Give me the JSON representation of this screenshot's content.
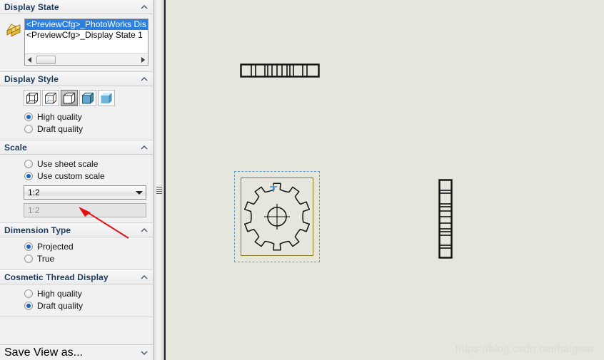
{
  "app": {
    "name": "SolidWorks Drawing View PropertyManager"
  },
  "panel": {
    "sections": [
      {
        "id": "display-state",
        "title": "Display State",
        "collapse_icon": "chevron-up-icon",
        "icon": "display-state-block-icon",
        "list": {
          "items": [
            {
              "label": "<PreviewCfg>_PhotoWorks Dis",
              "selected": true
            },
            {
              "label": "<PreviewCfg>_Display State 1",
              "selected": false
            }
          ],
          "scrollbar": {
            "left_arrow": "scroll-left-arrow-icon",
            "right_arrow": "scroll-right-arrow-icon"
          }
        }
      },
      {
        "id": "display-style",
        "title": "Display Style",
        "collapse_icon": "chevron-up-icon",
        "styles": [
          {
            "name": "wireframe-icon",
            "label": "Wireframe",
            "active": false
          },
          {
            "name": "hidden-lines-visible-icon",
            "label": "Hidden Lines Visible",
            "active": false
          },
          {
            "name": "hidden-lines-removed-icon",
            "label": "Hidden Lines Removed",
            "active": true
          },
          {
            "name": "shaded-with-edges-icon",
            "label": "Shaded With Edges",
            "active": false
          },
          {
            "name": "shaded-icon",
            "label": "Shaded",
            "active": false
          }
        ],
        "options": [
          {
            "label": "High quality",
            "selected": true
          },
          {
            "label": "Draft quality",
            "selected": false
          }
        ]
      },
      {
        "id": "scale",
        "title": "Scale",
        "collapse_icon": "chevron-up-icon",
        "options": [
          {
            "label": "Use sheet scale",
            "selected": false
          },
          {
            "label": "Use custom scale",
            "selected": true
          }
        ],
        "scale_combo": {
          "value": "1:2",
          "dropdown_icon": "chevron-down-icon"
        },
        "scale_field": {
          "value": "1:2",
          "enabled": false
        }
      },
      {
        "id": "dimension-type",
        "title": "Dimension Type",
        "collapse_icon": "chevron-up-icon",
        "options": [
          {
            "label": "Projected",
            "selected": true
          },
          {
            "label": "True",
            "selected": false
          }
        ]
      },
      {
        "id": "cosmetic-thread-display",
        "title": "Cosmetic Thread Display",
        "collapse_icon": "chevron-up-icon",
        "options": [
          {
            "label": "High quality",
            "selected": false
          },
          {
            "label": "Draft quality",
            "selected": true
          }
        ]
      },
      {
        "id": "save-view-as",
        "title": "Save View as...",
        "collapse_icon": "chevron-down-icon",
        "collapsed": true
      }
    ]
  },
  "splitter": {
    "grip_icon": "splitter-grip-icon",
    "pin_icon": "panel-collapse-dot-icon"
  },
  "canvas": {
    "background_color": "#e6e6dc",
    "views": [
      {
        "id": "top-view",
        "name": "gear-top-view",
        "description": "Gear top view rectangle with tooth edge lines"
      },
      {
        "id": "front-view",
        "name": "gear-front-view",
        "description": "Gear front view, 12 teeth, with center crosshair circle",
        "selected": true,
        "selection_border_color": "#5b9bd5",
        "view_border_color": "#8a7a1e",
        "anchor_icon": "view-anchor-crosshair-icon"
      },
      {
        "id": "side-view",
        "name": "gear-side-view",
        "description": "Gear right side view, tall rectangle with edge lines"
      }
    ]
  },
  "watermark": {
    "text": "https://blog.csdn.net/haigear"
  },
  "colors": {
    "accent_selection": "#2a7fe0",
    "radio_dot": "#1565c0",
    "canvas_bg": "#e6e6dc",
    "annotation_arrow": "#e31212",
    "view_border": "#8a7a1e",
    "section_title": "#1b3a5c"
  }
}
